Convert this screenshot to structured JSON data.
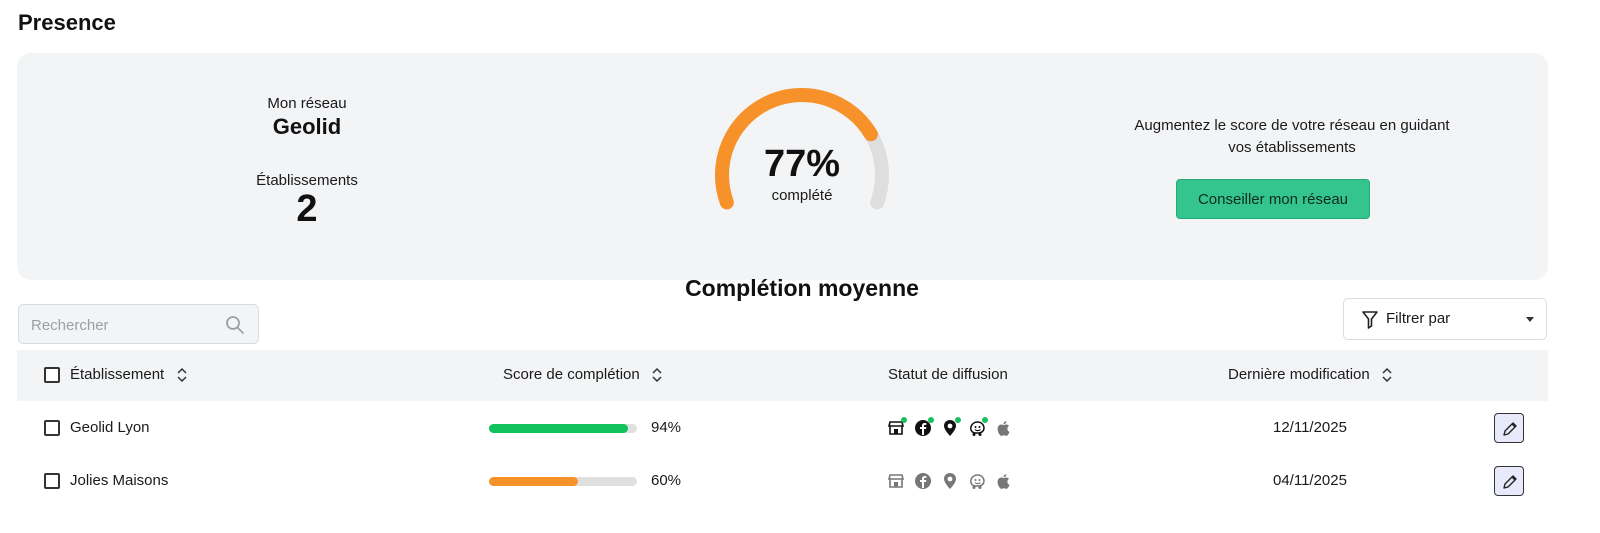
{
  "page": {
    "title": "Presence"
  },
  "summary": {
    "network_label": "Mon réseau",
    "network_name": "Geolid",
    "establishments_label": "Établissements",
    "establishments_count": "2",
    "completion_percent_text": "77%",
    "completion_percent": 77,
    "completion_sub": "complété",
    "completion_caption": "Complétion moyenne",
    "advice_text": "Augmentez le score de votre réseau en guidant vos établissements",
    "advice_button": "Conseiller mon réseau",
    "colors": {
      "gauge_fill": "#f7922a",
      "gauge_track": "#dedede",
      "button": "#34c58f"
    }
  },
  "search": {
    "placeholder": "Rechercher",
    "icon": "search-icon"
  },
  "filter": {
    "label": "Filtrer par",
    "icon": "filter-icon"
  },
  "table": {
    "columns": [
      "Établissement",
      "Score de complétion",
      "Statut de diffusion",
      "Dernière modification"
    ],
    "rows": [
      {
        "name": "Geolid Lyon",
        "score": 94,
        "score_text": "94%",
        "bar_color": "#11c15b",
        "status_icons": [
          "google-business-icon",
          "facebook-icon",
          "maps-pin-icon",
          "waze-icon",
          "apple-icon"
        ],
        "status_active": [
          true,
          true,
          true,
          true,
          false
        ],
        "date": "12/11/2025"
      },
      {
        "name": "Jolies Maisons",
        "score": 60,
        "score_text": "60%",
        "bar_color": "#f7922a",
        "status_icons": [
          "google-business-icon",
          "facebook-icon",
          "maps-pin-icon",
          "waze-icon",
          "apple-icon"
        ],
        "status_active": [
          false,
          false,
          false,
          false,
          false
        ],
        "date": "04/11/2025"
      }
    ]
  }
}
